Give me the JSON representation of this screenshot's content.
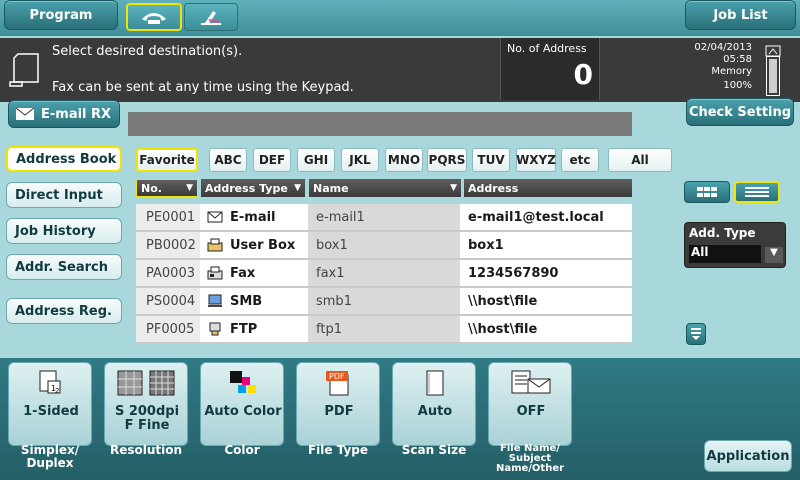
{
  "top": {
    "program_label": "Program",
    "job_list_label": "Job List"
  },
  "message": {
    "line1": "Select desired destination(s).",
    "line2": "Fax can be sent at any time using the Keypad."
  },
  "counter": {
    "label": "No. of Address",
    "value": "0"
  },
  "status": {
    "date": "02/04/2013",
    "time": "05:58",
    "memory_label": "Memory",
    "memory_value": "100%"
  },
  "email_rx_label": "E-mail RX",
  "check_setting_label": "Check Setting",
  "nav": {
    "address_book": "Address Book",
    "direct_input": "Direct Input",
    "job_history": "Job History",
    "addr_search": "Addr. Search",
    "address_reg": "Address Reg."
  },
  "index_tabs": [
    "Favorite",
    "ABC",
    "DEF",
    "GHI",
    "JKL",
    "MNO",
    "PQRS",
    "TUV",
    "WXYZ",
    "etc",
    "All"
  ],
  "table": {
    "headers": {
      "no": "No.",
      "type": "Address Type",
      "name": "Name",
      "address": "Address"
    },
    "rows": [
      {
        "no": "PE0001",
        "type": "E-mail",
        "icon": "email-icon",
        "name": "e-mail1",
        "address": "e-mail1@test.local"
      },
      {
        "no": "PB0002",
        "type": "User Box",
        "icon": "user-box-icon",
        "name": "box1",
        "address": "box1"
      },
      {
        "no": "PA0003",
        "type": "Fax",
        "icon": "fax-icon",
        "name": "fax1",
        "address": "1234567890"
      },
      {
        "no": "PS0004",
        "type": "SMB",
        "icon": "smb-icon",
        "name": "smb1",
        "address": "\\\\host\\file"
      },
      {
        "no": "PF0005",
        "type": "FTP",
        "icon": "ftp-icon",
        "name": "ftp1",
        "address": "\\\\host\\file"
      }
    ]
  },
  "add_type": {
    "label": "Add. Type",
    "value": "All"
  },
  "functions": [
    {
      "value": "1-Sided",
      "label1": "Simplex/",
      "label2": "Duplex"
    },
    {
      "value1": "S 200dpi",
      "value2": "F Fine",
      "label": "Resolution"
    },
    {
      "value": "Auto Color",
      "label": "Color"
    },
    {
      "value": "PDF",
      "label": "File Type"
    },
    {
      "value": "Auto",
      "label": "Scan Size"
    },
    {
      "value": "OFF",
      "label1": "File Name/",
      "label2": "Subject",
      "label3": "Name/Other"
    }
  ],
  "application_label": "Application",
  "colors": {
    "accent_yellow": "#f2e300",
    "teal_dark": "#2a6f78",
    "panel_bg": "#a9d8dc"
  }
}
